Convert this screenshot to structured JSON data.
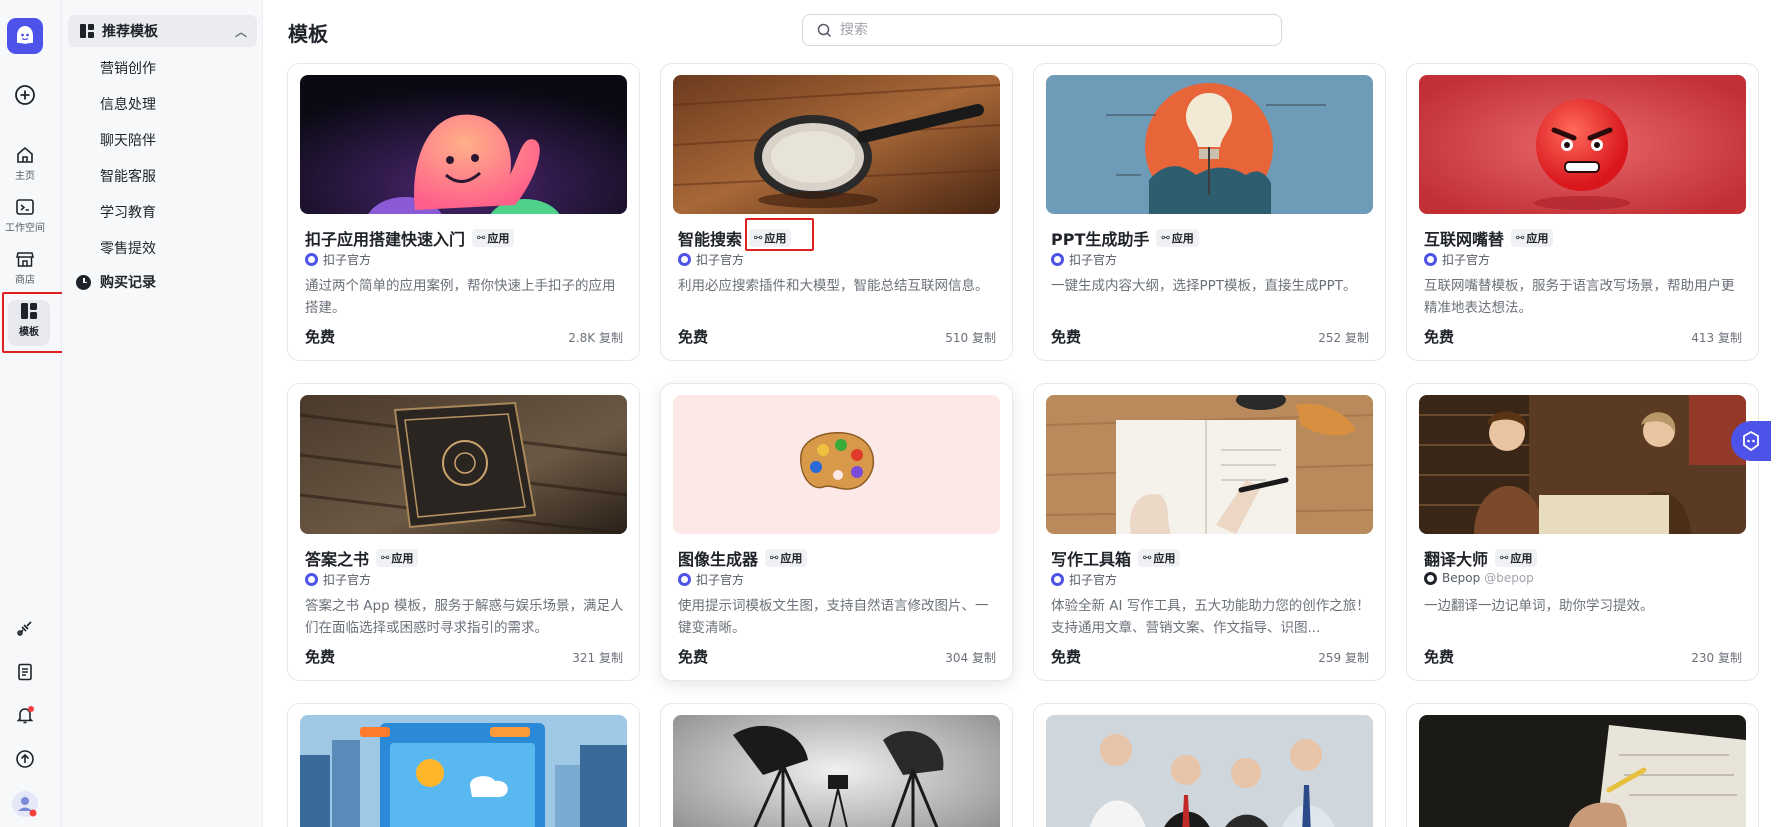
{
  "rail": {
    "items": [
      {
        "label": "主页"
      },
      {
        "label": "工作空间"
      },
      {
        "label": "商店"
      },
      {
        "label": "模板"
      }
    ]
  },
  "categories": {
    "header": "推荐模板",
    "items": [
      "营销创作",
      "信息处理",
      "聊天陪伴",
      "智能客服",
      "学习教育",
      "零售提效"
    ],
    "purchase": "购买记录"
  },
  "page": {
    "title": "模板",
    "search_placeholder": "搜索"
  },
  "tag_label": "应用",
  "price_label": "免费",
  "cards": [
    {
      "title": "扣子应用搭建快速入门",
      "author": "扣子官方",
      "desc": "通过两个简单的应用案例，帮你快速上手扣子的应用搭建。",
      "copies": "2.8K 复制"
    },
    {
      "title": "智能搜索",
      "author": "扣子官方",
      "desc": "利用必应搜索插件和大模型，智能总结互联网信息。",
      "copies": "510 复制"
    },
    {
      "title": "PPT生成助手",
      "author": "扣子官方",
      "desc": "一键生成内容大纲，选择PPT模板，直接生成PPT。",
      "copies": "252 复制"
    },
    {
      "title": "互联网嘴替",
      "author": "扣子官方",
      "desc": "互联网嘴替模板，服务于语言改写场景，帮助用户更精准地表达想法。",
      "copies": "413 复制"
    },
    {
      "title": "答案之书",
      "author": "扣子官方",
      "desc": "答案之书 App 模板，服务于解惑与娱乐场景，满足人们在面临选择或困惑时寻求指引的需求。",
      "copies": "321 复制"
    },
    {
      "title": "图像生成器",
      "author": "扣子官方",
      "desc": "使用提示词模板文生图，支持自然语言修改图片、一键变清晰。",
      "copies": "304 复制"
    },
    {
      "title": "写作工具箱",
      "author": "扣子官方",
      "desc": "体验全新 AI 写作工具，五大功能助力您的创作之旅！支持通用文章、营销文案、作文指导、识图...",
      "copies": "259 复制"
    },
    {
      "title": "翻译大师",
      "author": "Bepop",
      "handle": "@bepop",
      "desc": "一边翻译一边记单词，助你学习提效。",
      "copies": "230 复制"
    }
  ]
}
